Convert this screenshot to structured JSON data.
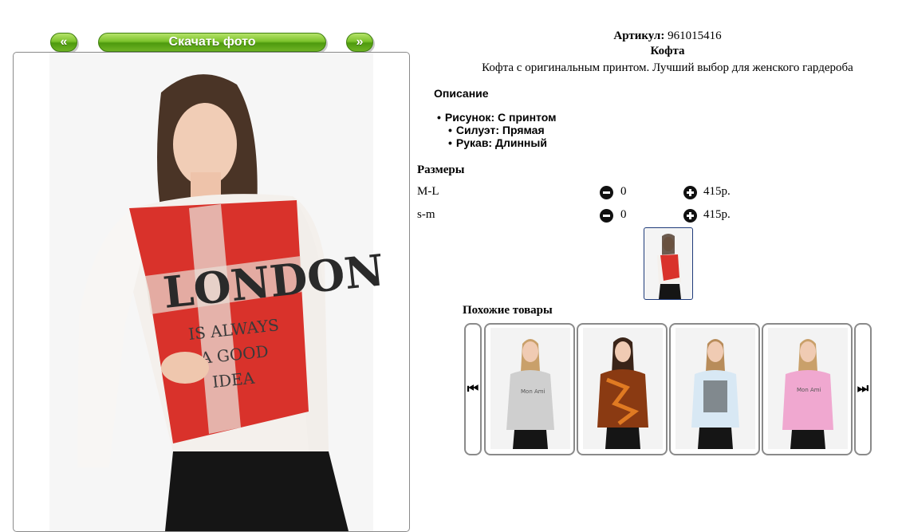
{
  "nav": {
    "prev_label": "«",
    "download_label": "Скачать фото",
    "next_label": "»"
  },
  "product": {
    "sku_label": "Артикул:",
    "sku_value": "961015416",
    "name": "Кофта",
    "tagline": "Кофта с оригинальным принтом. Лучший выбор для женского гардероба",
    "description_title": "Описание",
    "attributes": [
      "Рисунок: С принтом",
      "Силуэт: Прямая",
      "Рукав: Длинный"
    ],
    "photo_print_text": [
      "LONDON",
      "IS ALWAYS",
      "A GOOD",
      "IDEA"
    ]
  },
  "sizes": {
    "title": "Размеры",
    "rows": [
      {
        "name": "M-L",
        "qty": "0",
        "price": "415р."
      },
      {
        "name": "s-m",
        "qty": "0",
        "price": "415р."
      }
    ]
  },
  "similar": {
    "title": "Похожие товары",
    "prev_icon": "skip-back-icon",
    "next_icon": "skip-forward-icon",
    "items": [
      {
        "print": "Mon Ami",
        "color": "#cfcfcf"
      },
      {
        "print": "",
        "color": "#8a3a12"
      },
      {
        "print": "",
        "color": "#d8e8f4"
      },
      {
        "print": "Mon Ami",
        "color": "#f0a8d0"
      }
    ]
  },
  "colors": {
    "accent_green": "#6fb324",
    "frame_border": "#8a8a8a",
    "thumb_border": "#1f3b7a",
    "print_red": "#d9322b"
  }
}
